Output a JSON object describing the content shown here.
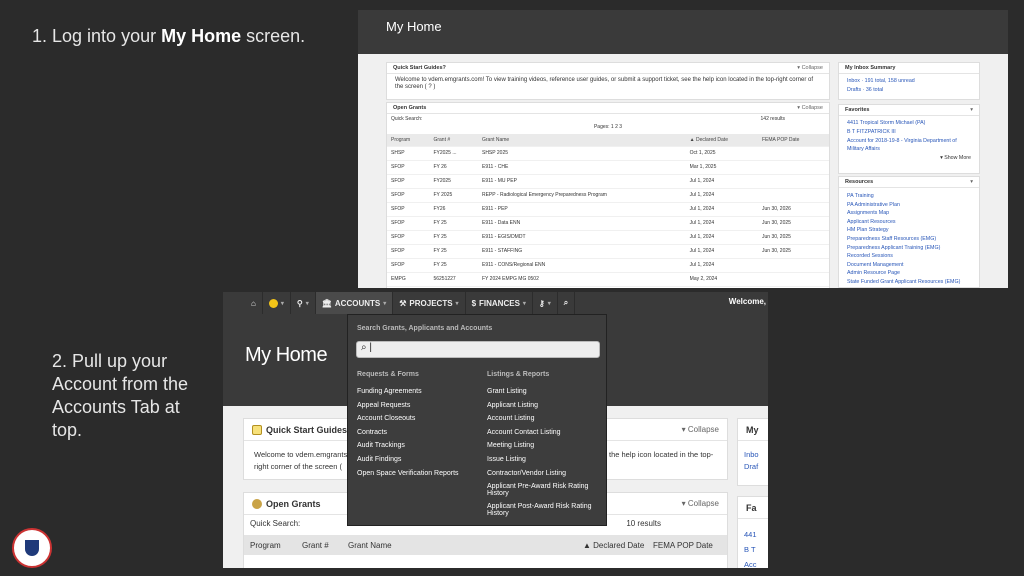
{
  "step1": {
    "prefix": "1. Log into your ",
    "bold": "My Home",
    "suffix": " screen."
  },
  "step2": {
    "text": "2. Pull up your Account from the Accounts Tab at top."
  },
  "shot1": {
    "title": "My Home",
    "quick_start": {
      "title": "Quick Start Guides?",
      "collapse": "▾ Collapse",
      "body": "Welcome to vdem.emgrants.com! To view training videos, reference user guides, or submit a support ticket, see the help icon located in the top-right corner of the screen ( ? )"
    },
    "open_grants": {
      "title": "Open Grants",
      "collapse": "▾ Collapse",
      "quick_search": "Quick Search:",
      "results": "142 results",
      "pages": "Pages: 1 2 3",
      "headers": [
        "Program",
        "Grant #",
        "Grant Name",
        "▲ Declared Date",
        "FEMA POP Date"
      ],
      "rows": [
        [
          "SHSP",
          "FY2025 ...",
          "SHSP 2025",
          "Oct 1, 2025",
          ""
        ],
        [
          "SFOP",
          "FY 26",
          "E911 - CHE",
          "Mar 1, 2025",
          ""
        ],
        [
          "SFOP",
          "FY2025",
          "E911 - MU PEP",
          "Jul 1, 2024",
          ""
        ],
        [
          "SFOP",
          "FY 2025",
          "REPP - Radiological Emergency Preparedness Program",
          "Jul 1, 2024",
          ""
        ],
        [
          "SFOP",
          "FY26",
          "E911 - PEP",
          "Jul 1, 2024",
          "Jun 30, 2026"
        ],
        [
          "SFOP",
          "FY 25",
          "E911 - Data ENN",
          "Jul 1, 2024",
          "Jun 30, 2025"
        ],
        [
          "SFOP",
          "FY 25",
          "E911 - EGIS/DMDT",
          "Jul 1, 2024",
          "Jun 30, 2025"
        ],
        [
          "SFOP",
          "FY 25",
          "E911 - STAFFING",
          "Jul 1, 2024",
          "Jun 30, 2025"
        ],
        [
          "SFOP",
          "FY 25",
          "E911 - CONS/Regional ENN",
          "Jul 1, 2024",
          ""
        ],
        [
          "EMPG",
          "56251227",
          "FY 2024 EMPG MG 0502",
          "May 2, 2024",
          ""
        ]
      ]
    },
    "inbox": {
      "title": "My Inbox Summary",
      "items": [
        "Inbox · 191 total, 158 unread",
        "Drafts · 36 total"
      ]
    },
    "favorites": {
      "title": "Favorites",
      "items": [
        "4411 Tropical Storm Michael (PA)",
        "B T FITZPATRICK III",
        "Account for 2018-19-8 - Virginia Department of Military Affairs"
      ],
      "more": "▾ Show More"
    },
    "resources": {
      "title": "Resources",
      "items": [
        "PA Training",
        "PA Administrative Plan",
        "Assignments Map",
        "Applicant Resources",
        "HM Plan Strategy",
        "Preparedness Staff Resources (EMG)",
        "Preparedness Applicant Training (EMG)",
        "Recorded Sessions",
        "Document Management",
        "Admin Resource Page",
        "State Funded Grant Applicant Resources (EMG)",
        "State Funded Grant Staff Resources (EMG)"
      ]
    }
  },
  "shot2": {
    "nav": {
      "accounts": "ACCOUNTS",
      "projects": "PROJECTS",
      "finances": "FINANCES",
      "welcome": "Welcome,"
    },
    "title": "My Home",
    "dropdown": {
      "search_header": "Search Grants, Applicants and Accounts",
      "search_value": "|",
      "col1_header": "Requests & Forms",
      "col1": [
        "Funding Agreements",
        "Appeal Requests",
        "Account Closeouts",
        "Contracts",
        "Audit Trackings",
        "Audit Findings",
        "Open Space Verification Reports"
      ],
      "col2_header": "Listings & Reports",
      "col2": [
        "Grant Listing",
        "Applicant Listing",
        "Account Listing",
        "Account Contact Listing",
        "Meeting Listing",
        "Issue Listing",
        "Contractor/Vendor Listing",
        "Applicant Pre-Award Risk Rating History",
        "Applicant Post-Award Risk Rating History"
      ]
    },
    "quick_start": {
      "title": "Quick Start Guides?",
      "collapse": "▾ Collapse",
      "body_left": "Welcome to vdem.emgrants.c",
      "body_left2": "right corner of the screen (",
      "body_right": "the help icon located in the top-"
    },
    "open_grants": {
      "title": "Open Grants",
      "collapse": "▾ Collapse",
      "quick_search": "Quick Search:",
      "results": "10 results",
      "headers": [
        "Program",
        "Grant #",
        "Grant Name",
        "▲ Declared Date",
        "FEMA POP Date"
      ]
    },
    "side": {
      "inbox_title": "My",
      "inbox_items": [
        "Inbo",
        "Draf"
      ],
      "fav_title": "Fa",
      "fav_items": [
        "441",
        "B T",
        "Acc"
      ]
    }
  }
}
